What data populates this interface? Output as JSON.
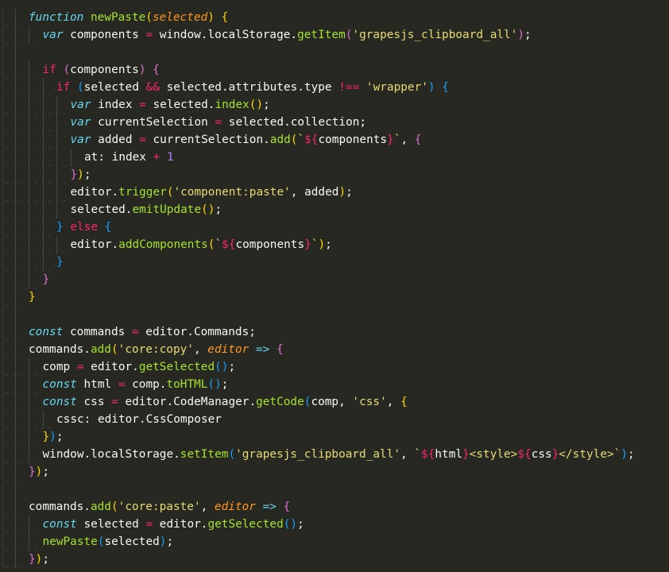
{
  "editor": {
    "theme_colors": {
      "background": "#272822",
      "foreground": "#f8f8f2",
      "keyword": "#66d9ef",
      "control": "#f92672",
      "function": "#a6e22e",
      "parameter": "#fd971f",
      "string": "#e6db74",
      "number": "#ae81ff",
      "bracket_level_1": "#ffd700",
      "bracket_level_2": "#da70d6",
      "bracket_level_3": "#179fff"
    },
    "lines": [
      {
        "indent": 0,
        "tokens": [
          [
            "kw",
            "function"
          ],
          [
            "p",
            " "
          ],
          [
            "fn",
            "newPaste"
          ],
          [
            "b1",
            "("
          ],
          [
            "param",
            "selected"
          ],
          [
            "b1",
            ")"
          ],
          [
            "p",
            " "
          ],
          [
            "b1",
            "{"
          ]
        ]
      },
      {
        "indent": 1,
        "tokens": [
          [
            "kw",
            "var"
          ],
          [
            "p",
            " components "
          ],
          [
            "op",
            "="
          ],
          [
            "p",
            " window.localStorage."
          ],
          [
            "fn",
            "getItem"
          ],
          [
            "b2",
            "("
          ],
          [
            "str",
            "'grapesjs_clipboard_all'"
          ],
          [
            "b2",
            ")"
          ],
          [
            "p",
            ";"
          ]
        ]
      },
      {
        "indent": 0,
        "tokens": []
      },
      {
        "indent": 1,
        "tokens": [
          [
            "ctl",
            "if"
          ],
          [
            "p",
            " "
          ],
          [
            "b2",
            "("
          ],
          [
            "p",
            "components"
          ],
          [
            "b2",
            ")"
          ],
          [
            "p",
            " "
          ],
          [
            "b2",
            "{"
          ]
        ]
      },
      {
        "indent": 2,
        "tokens": [
          [
            "ctl",
            "if"
          ],
          [
            "p",
            " "
          ],
          [
            "b3",
            "("
          ],
          [
            "p",
            "selected "
          ],
          [
            "op",
            "&&"
          ],
          [
            "p",
            " selected.attributes.type "
          ],
          [
            "op",
            "!=="
          ],
          [
            "p",
            " "
          ],
          [
            "str",
            "'wrapper'"
          ],
          [
            "b3",
            ")"
          ],
          [
            "p",
            " "
          ],
          [
            "b3",
            "{"
          ]
        ]
      },
      {
        "indent": 3,
        "tokens": [
          [
            "kw",
            "var"
          ],
          [
            "p",
            " index "
          ],
          [
            "op",
            "="
          ],
          [
            "p",
            " selected."
          ],
          [
            "fn",
            "index"
          ],
          [
            "b1",
            "()"
          ],
          [
            "p",
            ";"
          ]
        ]
      },
      {
        "indent": 3,
        "tokens": [
          [
            "kw",
            "var"
          ],
          [
            "p",
            " currentSelection "
          ],
          [
            "op",
            "="
          ],
          [
            "p",
            " selected.collection;"
          ]
        ]
      },
      {
        "indent": 3,
        "tokens": [
          [
            "kw",
            "var"
          ],
          [
            "p",
            " added "
          ],
          [
            "op",
            "="
          ],
          [
            "p",
            " currentSelection."
          ],
          [
            "fn",
            "add"
          ],
          [
            "b1",
            "("
          ],
          [
            "tpl",
            "`"
          ],
          [
            "interp",
            "${"
          ],
          [
            "p",
            "components"
          ],
          [
            "interp",
            "}"
          ],
          [
            "tpl",
            "`"
          ],
          [
            "p",
            ", "
          ],
          [
            "b2",
            "{"
          ]
        ]
      },
      {
        "indent": 4,
        "tokens": [
          [
            "p",
            "at: index "
          ],
          [
            "op",
            "+"
          ],
          [
            "p",
            " "
          ],
          [
            "num",
            "1"
          ]
        ]
      },
      {
        "indent": 3,
        "tokens": [
          [
            "b2",
            "}"
          ],
          [
            "b1",
            ")"
          ],
          [
            "p",
            ";"
          ]
        ]
      },
      {
        "indent": 3,
        "tokens": [
          [
            "p",
            "editor."
          ],
          [
            "fn",
            "trigger"
          ],
          [
            "b1",
            "("
          ],
          [
            "str",
            "'component:paste'"
          ],
          [
            "p",
            ", added"
          ],
          [
            "b1",
            ")"
          ],
          [
            "p",
            ";"
          ]
        ]
      },
      {
        "indent": 3,
        "tokens": [
          [
            "p",
            "selected."
          ],
          [
            "fn",
            "emitUpdate"
          ],
          [
            "b1",
            "()"
          ],
          [
            "p",
            ";"
          ]
        ]
      },
      {
        "indent": 2,
        "tokens": [
          [
            "b3",
            "}"
          ],
          [
            "p",
            " "
          ],
          [
            "ctl",
            "else"
          ],
          [
            "p",
            " "
          ],
          [
            "b3",
            "{"
          ]
        ]
      },
      {
        "indent": 3,
        "tokens": [
          [
            "p",
            "editor."
          ],
          [
            "fn",
            "addComponents"
          ],
          [
            "b1",
            "("
          ],
          [
            "tpl",
            "`"
          ],
          [
            "interp",
            "${"
          ],
          [
            "p",
            "components"
          ],
          [
            "interp",
            "}"
          ],
          [
            "tpl",
            "`"
          ],
          [
            "b1",
            ")"
          ],
          [
            "p",
            ";"
          ]
        ]
      },
      {
        "indent": 2,
        "tokens": [
          [
            "b3",
            "}"
          ]
        ]
      },
      {
        "indent": 1,
        "tokens": [
          [
            "b2",
            "}"
          ]
        ]
      },
      {
        "indent": 0,
        "tokens": [
          [
            "b1",
            "}"
          ]
        ]
      },
      {
        "indent": 0,
        "tokens": []
      },
      {
        "indent": 0,
        "tokens": [
          [
            "kw",
            "const"
          ],
          [
            "p",
            " commands "
          ],
          [
            "op",
            "="
          ],
          [
            "p",
            " editor.Commands;"
          ]
        ]
      },
      {
        "indent": 0,
        "tokens": [
          [
            "p",
            "commands."
          ],
          [
            "fn",
            "add"
          ],
          [
            "b1",
            "("
          ],
          [
            "str",
            "'core:copy'"
          ],
          [
            "p",
            ", "
          ],
          [
            "param",
            "editor"
          ],
          [
            "p",
            " "
          ],
          [
            "arrow",
            "=>"
          ],
          [
            "p",
            " "
          ],
          [
            "b2",
            "{"
          ]
        ]
      },
      {
        "indent": 1,
        "tokens": [
          [
            "p",
            "comp "
          ],
          [
            "op",
            "="
          ],
          [
            "p",
            " editor."
          ],
          [
            "fn",
            "getSelected"
          ],
          [
            "b3",
            "()"
          ],
          [
            "p",
            ";"
          ]
        ]
      },
      {
        "indent": 1,
        "tokens": [
          [
            "kw",
            "const"
          ],
          [
            "p",
            " html "
          ],
          [
            "op",
            "="
          ],
          [
            "p",
            " comp."
          ],
          [
            "fn",
            "toHTML"
          ],
          [
            "b3",
            "()"
          ],
          [
            "p",
            ";"
          ]
        ]
      },
      {
        "indent": 1,
        "tokens": [
          [
            "kw",
            "const"
          ],
          [
            "p",
            " css "
          ],
          [
            "op",
            "="
          ],
          [
            "p",
            " editor.CodeManager."
          ],
          [
            "fn",
            "getCode"
          ],
          [
            "b3",
            "("
          ],
          [
            "p",
            "comp, "
          ],
          [
            "str",
            "'css'"
          ],
          [
            "p",
            ", "
          ],
          [
            "b1",
            "{"
          ]
        ]
      },
      {
        "indent": 2,
        "tokens": [
          [
            "p",
            "cssc: editor.CssComposer"
          ]
        ]
      },
      {
        "indent": 1,
        "tokens": [
          [
            "b1",
            "}"
          ],
          [
            "b3",
            ")"
          ],
          [
            "p",
            ";"
          ]
        ]
      },
      {
        "indent": 1,
        "tokens": [
          [
            "p",
            "window.localStorage."
          ],
          [
            "fn",
            "setItem"
          ],
          [
            "b3",
            "("
          ],
          [
            "str",
            "'grapesjs_clipboard_all'"
          ],
          [
            "p",
            ", "
          ],
          [
            "tpl",
            "`"
          ],
          [
            "interp",
            "${"
          ],
          [
            "p",
            "html"
          ],
          [
            "interp",
            "}"
          ],
          [
            "tpl",
            "<style>"
          ],
          [
            "interp",
            "${"
          ],
          [
            "p",
            "css"
          ],
          [
            "interp",
            "}"
          ],
          [
            "tpl",
            "</style>`"
          ],
          [
            "b3",
            ")"
          ],
          [
            "p",
            ";"
          ]
        ]
      },
      {
        "indent": 0,
        "tokens": [
          [
            "b2",
            "}"
          ],
          [
            "b1",
            ")"
          ],
          [
            "p",
            ";"
          ]
        ]
      },
      {
        "indent": 0,
        "tokens": []
      },
      {
        "indent": 0,
        "tokens": [
          [
            "p",
            "commands."
          ],
          [
            "fn",
            "add"
          ],
          [
            "b1",
            "("
          ],
          [
            "str",
            "'core:paste'"
          ],
          [
            "p",
            ", "
          ],
          [
            "param",
            "editor"
          ],
          [
            "p",
            " "
          ],
          [
            "arrow",
            "=>"
          ],
          [
            "p",
            " "
          ],
          [
            "b2",
            "{"
          ]
        ]
      },
      {
        "indent": 1,
        "tokens": [
          [
            "kw",
            "const"
          ],
          [
            "p",
            " selected "
          ],
          [
            "op",
            "="
          ],
          [
            "p",
            " editor."
          ],
          [
            "fn",
            "getSelected"
          ],
          [
            "b3",
            "()"
          ],
          [
            "p",
            ";"
          ]
        ]
      },
      {
        "indent": 1,
        "tokens": [
          [
            "fn",
            "newPaste"
          ],
          [
            "b3",
            "("
          ],
          [
            "p",
            "selected"
          ],
          [
            "b3",
            ")"
          ],
          [
            "p",
            ";"
          ]
        ]
      },
      {
        "indent": 0,
        "tokens": [
          [
            "b2",
            "}"
          ],
          [
            "b1",
            ")"
          ],
          [
            "p",
            ";"
          ]
        ]
      }
    ]
  }
}
